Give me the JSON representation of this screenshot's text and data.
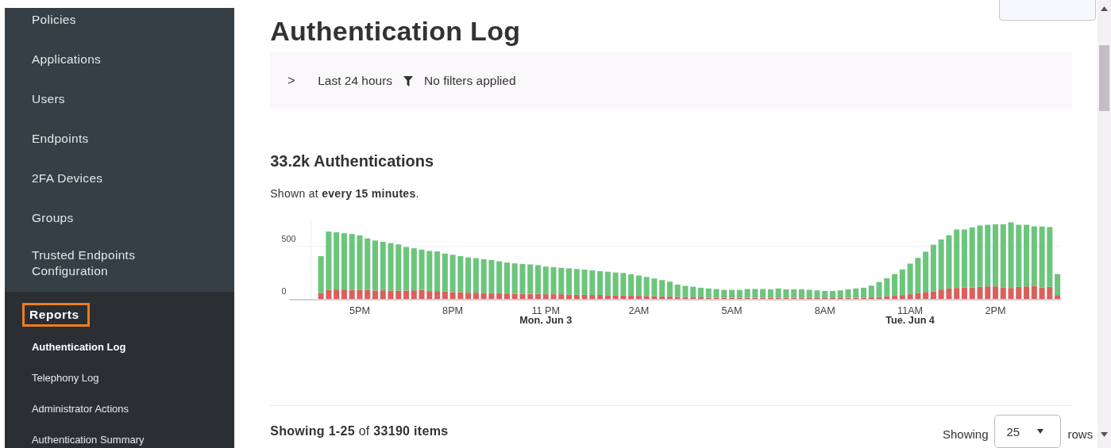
{
  "sidebar": {
    "items": [
      {
        "label": "Policies"
      },
      {
        "label": "Applications"
      },
      {
        "label": "Users"
      },
      {
        "label": "Endpoints"
      },
      {
        "label": "2FA Devices"
      },
      {
        "label": "Groups"
      },
      {
        "label": "Trusted Endpoints Configuration"
      }
    ],
    "section": {
      "label": "Reports",
      "highlighted": true,
      "children": [
        {
          "label": "Authentication Log",
          "selected": true
        },
        {
          "label": "Telephony Log",
          "selected": false
        },
        {
          "label": "Administrator Actions",
          "selected": false
        },
        {
          "label": "Authentication Summary",
          "selected": false
        }
      ]
    }
  },
  "page": {
    "title": "Authentication Log",
    "filter_bar": {
      "toggle": ">",
      "time_range": "Last 24 hours",
      "filters": "No filters applied"
    },
    "summary": {
      "title": "33.2k Authentications",
      "note": "Shown at **every 15 minutes**.",
      "chart_data": {
        "type": "bar",
        "stacked": true,
        "categories": [
          null,
          null,
          null,
          null,
          null,
          "5PM",
          null,
          null,
          null,
          null,
          null,
          null,
          null,
          null,
          null,
          null,
          null,
          "8PM",
          null,
          null,
          null,
          null,
          null,
          null,
          null,
          null,
          null,
          null,
          null,
          "11 PM\nMon. Jun 3",
          null,
          null,
          null,
          null,
          null,
          null,
          null,
          null,
          null,
          null,
          null,
          "2AM",
          null,
          null,
          null,
          null,
          null,
          null,
          null,
          null,
          null,
          null,
          null,
          "5AM",
          null,
          null,
          null,
          null,
          null,
          null,
          null,
          null,
          null,
          null,
          null,
          "8AM",
          null,
          null,
          null,
          null,
          null,
          null,
          null,
          null,
          null,
          null,
          "11AM\nTue. Jun 4",
          null,
          null,
          null,
          null,
          null,
          null,
          null,
          null,
          null,
          null,
          "2PM",
          null,
          null,
          null,
          null,
          null,
          null,
          null,
          null
        ],
        "ylim": [
          0,
          750
        ],
        "yticks": [
          0,
          500
        ],
        "series": [
          {
            "color": "#d9605c",
            "values": [
              55,
              85,
              90,
              90,
              85,
              88,
              85,
              80,
              82,
              80,
              80,
              80,
              82,
              85,
              75,
              75,
              70,
              65,
              65,
              60,
              60,
              58,
              55,
              55,
              52,
              50,
              50,
              48,
              48,
              45,
              45,
              45,
              42,
              40,
              40,
              38,
              38,
              36,
              35,
              32,
              30,
              30,
              28,
              25,
              25,
              22,
              20,
              18,
              15,
              15,
              12,
              12,
              10,
              10,
              10,
              10,
              12,
              10,
              10,
              10,
              10,
              10,
              10,
              10,
              8,
              8,
              8,
              8,
              10,
              10,
              12,
              15,
              20,
              25,
              30,
              37,
              45,
              55,
              67,
              70,
              90,
              100,
              105,
              110,
              110,
              115,
              120,
              120,
              110,
              105,
              115,
              120,
              125,
              110,
              115,
              37
            ]
          },
          {
            "color": "#6cc57c",
            "values": [
              353,
              558,
              546,
              536,
              534,
              518,
              492,
              477,
              463,
              452,
              440,
              415,
              401,
              385,
              383,
              378,
              363,
              356,
              343,
              336,
              329,
              321,
              316,
              304,
              295,
              289,
              284,
              281,
              274,
              264,
              259,
              252,
              250,
              245,
              240,
              234,
              227,
              224,
              217,
              216,
              205,
              193,
              182,
              170,
              155,
              143,
              117,
              107,
              102,
              92,
              88,
              83,
              77,
              77,
              77,
              85,
              83,
              85,
              82,
              90,
              82,
              82,
              82,
              77,
              74,
              69,
              69,
              74,
              82,
              90,
              95,
              112,
              142,
              172,
              207,
              245,
              292,
              337,
              383,
              447,
              477,
              507,
              557,
              552,
              572,
              585,
              587,
              592,
              602,
              625,
              592,
              587,
              567,
              580,
              570,
              200
            ]
          }
        ]
      }
    },
    "footer": {
      "showing": "**Showing 1-25** of **33190 items**",
      "page_size_label": "Showing",
      "page_size": "25",
      "page_size_suffix": "rows"
    }
  }
}
